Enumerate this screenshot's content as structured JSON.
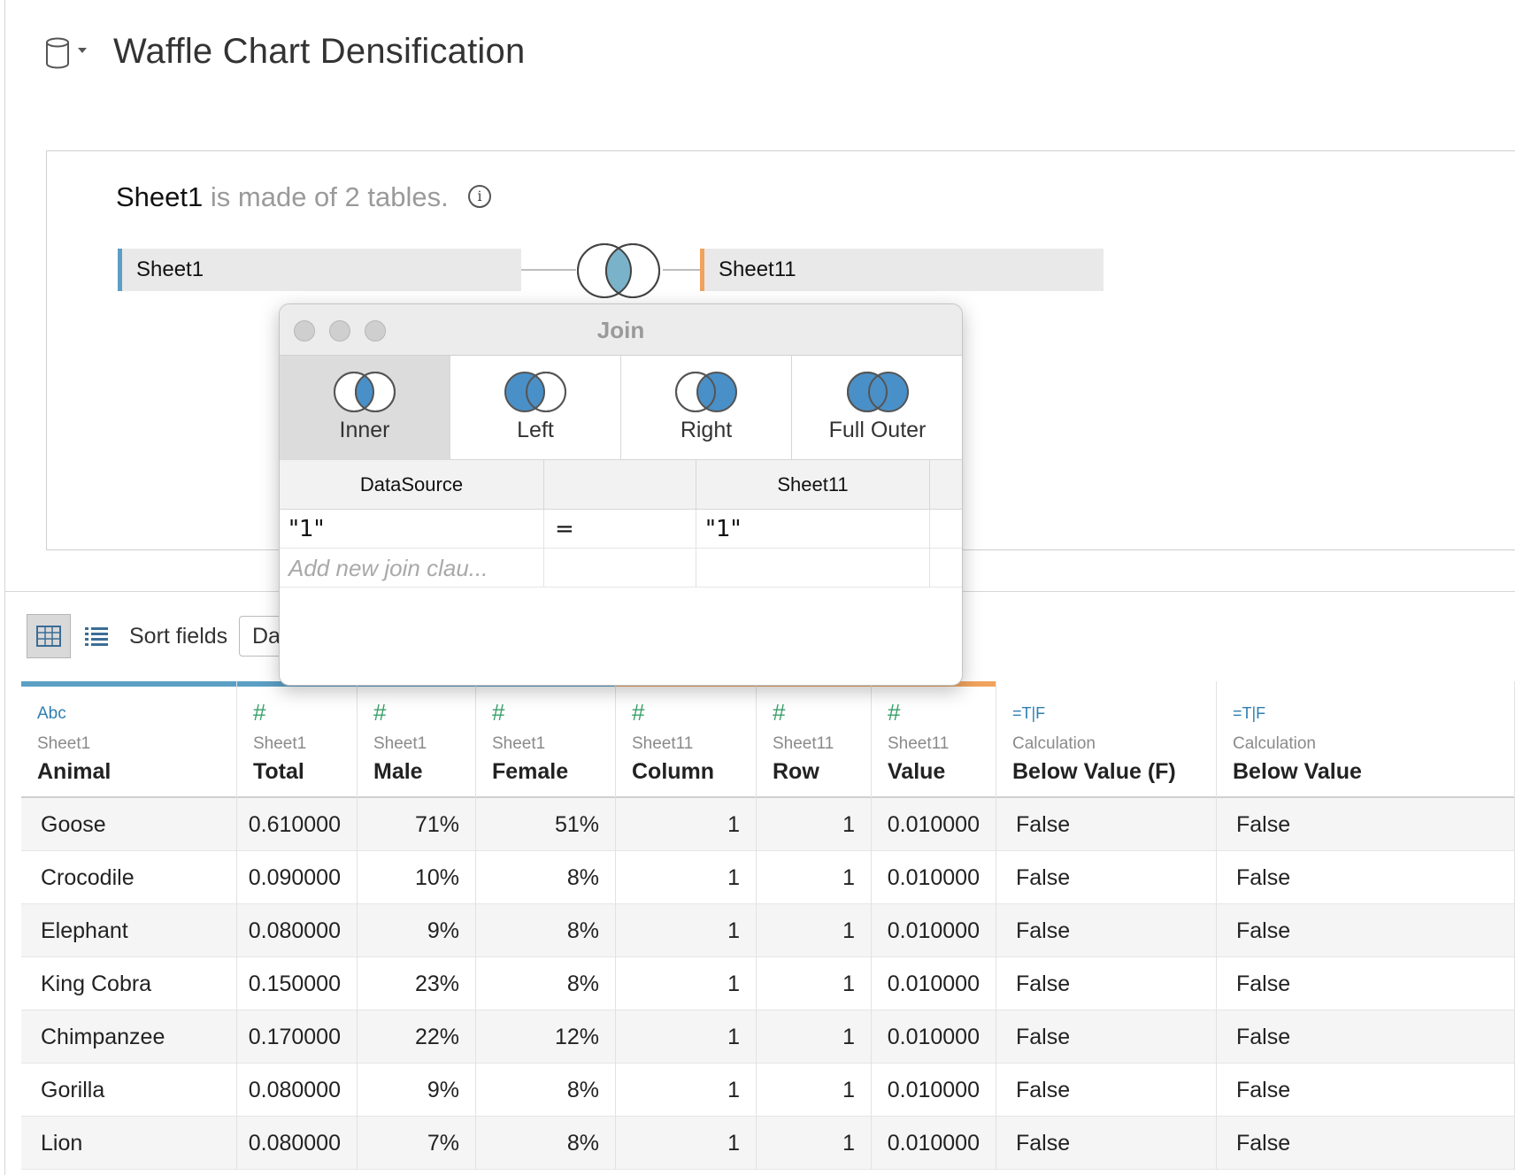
{
  "header": {
    "title": "Waffle Chart Densification"
  },
  "canvas": {
    "caption_sheet": "Sheet1",
    "caption_rest": "is made of 2 tables.",
    "left_table": "Sheet1",
    "right_table": "Sheet11"
  },
  "toolbar": {
    "sort_label": "Sort fields",
    "sort_value": "Da"
  },
  "join_dialog": {
    "title": "Join",
    "types": [
      {
        "label": "Inner",
        "selected": true
      },
      {
        "label": "Left",
        "selected": false
      },
      {
        "label": "Right",
        "selected": false
      },
      {
        "label": "Full Outer",
        "selected": false
      }
    ],
    "left_source": "DataSource",
    "right_source": "Sheet11",
    "clauses": [
      {
        "left": "\"1\"",
        "op": "=",
        "right": "\"1\""
      }
    ],
    "add_placeholder": "Add new join clau..."
  },
  "grid": {
    "columns": [
      {
        "type": "Abc",
        "source": "Sheet1",
        "field": "Animal"
      },
      {
        "type": "#",
        "source": "Sheet1",
        "field": "Total"
      },
      {
        "type": "#",
        "source": "Sheet1",
        "field": "Male"
      },
      {
        "type": "#",
        "source": "Sheet1",
        "field": "Female"
      },
      {
        "type": "#",
        "source": "Sheet11",
        "field": "Column"
      },
      {
        "type": "#",
        "source": "Sheet11",
        "field": "Row"
      },
      {
        "type": "#",
        "source": "Sheet11",
        "field": "Value"
      },
      {
        "type": "=T|F",
        "source": "Calculation",
        "field": "Below Value (F)"
      },
      {
        "type": "=T|F",
        "source": "Calculation",
        "field": "Below Value"
      }
    ],
    "rows": [
      [
        "Goose",
        "0.610000",
        "71%",
        "51%",
        "1",
        "1",
        "0.010000",
        "False",
        "False"
      ],
      [
        "Crocodile",
        "0.090000",
        "10%",
        "8%",
        "1",
        "1",
        "0.010000",
        "False",
        "False"
      ],
      [
        "Elephant",
        "0.080000",
        "9%",
        "8%",
        "1",
        "1",
        "0.010000",
        "False",
        "False"
      ],
      [
        "King Cobra",
        "0.150000",
        "23%",
        "8%",
        "1",
        "1",
        "0.010000",
        "False",
        "False"
      ],
      [
        "Chimpanzee",
        "0.170000",
        "22%",
        "12%",
        "1",
        "1",
        "0.010000",
        "False",
        "False"
      ],
      [
        "Gorilla",
        "0.080000",
        "9%",
        "8%",
        "1",
        "1",
        "0.010000",
        "False",
        "False"
      ],
      [
        "Lion",
        "0.080000",
        "7%",
        "8%",
        "1",
        "1",
        "0.010000",
        "False",
        "False"
      ]
    ]
  },
  "colors": {
    "sheet1_accent": "#5b9fc4",
    "sheet11_accent": "#f0a35e",
    "join_fill": "#4a90c8",
    "string_type": "#2f7fb0",
    "number_type": "#3aa06a"
  }
}
